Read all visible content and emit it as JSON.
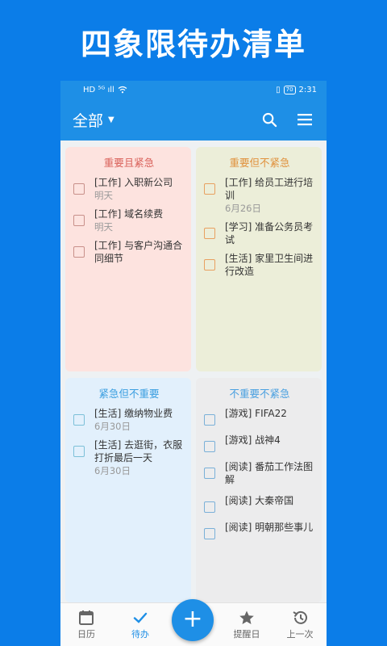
{
  "promo": {
    "title": "四象限待办清单"
  },
  "status": {
    "left": "HD ⁵ᴳ ıll",
    "battery": "70",
    "time": "2:31"
  },
  "appbar": {
    "filter_label": "全部",
    "search_icon": "search-icon",
    "menu_icon": "menu-icon"
  },
  "quadrants": [
    {
      "title": "重要且紧急",
      "tasks": [
        {
          "text": "[工作] 入职新公司",
          "date": "明天"
        },
        {
          "text": "[工作] 域名续费",
          "date": "明天"
        },
        {
          "text": "[工作] 与客户沟通合同细节",
          "date": ""
        }
      ]
    },
    {
      "title": "重要但不紧急",
      "tasks": [
        {
          "text": "[工作] 给员工进行培训",
          "date": "6月26日"
        },
        {
          "text": "[学习] 准备公务员考试",
          "date": ""
        },
        {
          "text": "[生活] 家里卫生间进行改造",
          "date": ""
        }
      ]
    },
    {
      "title": "紧急但不重要",
      "tasks": [
        {
          "text": "[生活] 缴纳物业费",
          "date": "6月30日"
        },
        {
          "text": "[生活] 去逛街，衣服打折最后一天",
          "date": "6月30日"
        }
      ]
    },
    {
      "title": "不重要不紧急",
      "tasks": [
        {
          "text": "[游戏] FIFA22",
          "date": ""
        },
        {
          "text": "[游戏] 战神4",
          "date": ""
        },
        {
          "text": "[阅读] 番茄工作法图解",
          "date": ""
        },
        {
          "text": "[阅读] 大秦帝国",
          "date": ""
        },
        {
          "text": "[阅读] 明朝那些事儿",
          "date": ""
        }
      ]
    }
  ],
  "nav": {
    "calendar": "日历",
    "todo": "待办",
    "add": "+",
    "reminder": "提醒日",
    "history": "上一次"
  }
}
